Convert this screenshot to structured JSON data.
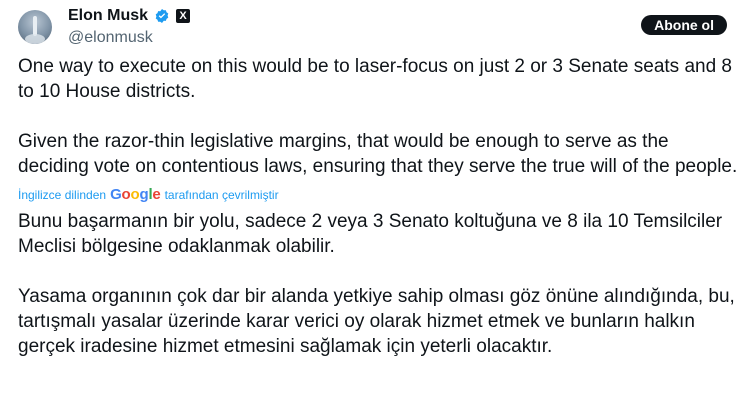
{
  "author": {
    "name": "Elon Musk",
    "handle": "@elonmusk",
    "verified_icon": "verified-badge-icon",
    "affiliation_icon": "x-logo-icon",
    "affiliation_label": "X"
  },
  "actions": {
    "subscribe_label": "Abone ol"
  },
  "tweet": {
    "paragraph_1": "One way to execute on this would be to laser-focus on just 2 or 3 Senate seats and 8 to 10 House districts.",
    "paragraph_2": "Given the razor-thin legislative margins, that would be enough to serve as the deciding vote on contentious laws, ensuring that they serve the true will of the people."
  },
  "translation": {
    "prefix": "İngilizce dilinden",
    "provider_letters": [
      "G",
      "o",
      "o",
      "g",
      "l",
      "e"
    ],
    "suffix": "tarafından çevrilmiştir",
    "paragraph_1": "Bunu başarmanın bir yolu, sadece 2 veya 3 Senato koltuğuna ve 8 ila 10 Temsilciler Meclisi bölgesine odaklanmak olabilir.",
    "paragraph_2": "Yasama organının çok dar bir alanda yetkiye sahip olması göz önüne alındığında, bu, tartışmalı yasalar üzerinde karar verici oy olarak hizmet etmek ve bunların halkın gerçek iradesine hizmet etmesini sağlamak için yeterli olacaktır."
  },
  "colors": {
    "text": "#0f1419",
    "secondary": "#536471",
    "link": "#1d9bf0",
    "verified": "#1d9bf0",
    "button_bg": "#0f1419"
  }
}
